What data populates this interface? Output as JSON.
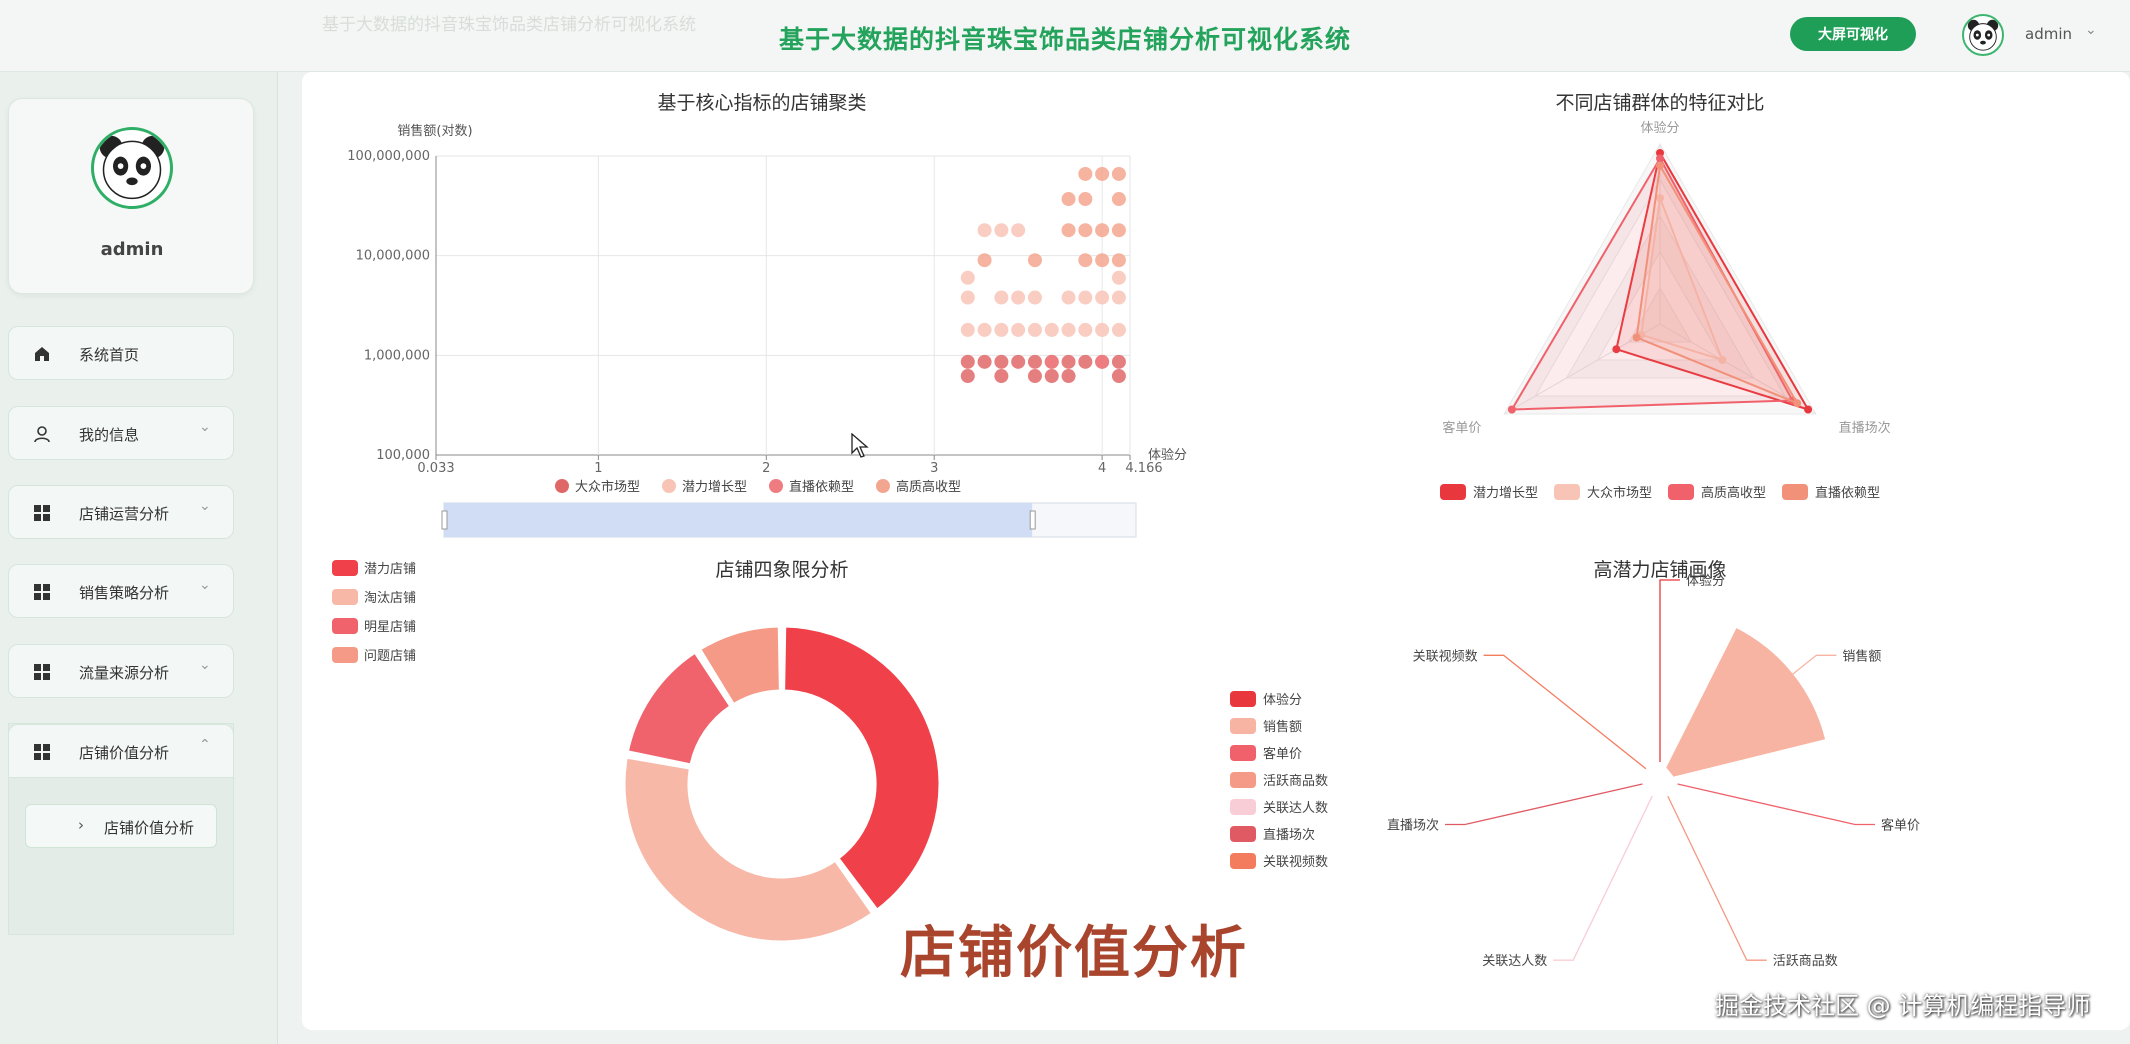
{
  "header": {
    "faint_title": "基于大数据的抖音珠宝饰品类店铺分析可视化系统",
    "title": "基于大数据的抖音珠宝饰品类店铺分析可视化系统",
    "screen_button": "大屏可视化",
    "username": "admin",
    "caret": "⌄"
  },
  "sidebar": {
    "profile_name": "admin",
    "items": [
      {
        "label": "系统首页",
        "icon": "home-icon",
        "caret": ""
      },
      {
        "label": "我的信息",
        "icon": "user-icon",
        "caret": "⌄"
      },
      {
        "label": "店铺运营分析",
        "icon": "grid-icon",
        "caret": "⌄"
      },
      {
        "label": "销售策略分析",
        "icon": "grid-icon",
        "caret": "⌄"
      },
      {
        "label": "流量来源分析",
        "icon": "grid-icon",
        "caret": "⌄"
      },
      {
        "label": "店铺价值分析",
        "icon": "grid-icon",
        "caret": "⌃"
      }
    ],
    "sub_item": {
      "label": "店铺价值分析",
      "arrow": "›"
    }
  },
  "overlay_text": "店铺价值分析",
  "watermark": "掘金技术社区 @ 计算机编程指导师",
  "colors": {
    "accent": "#23a35b",
    "red": "#e8383d",
    "salmon": "#f7b4a3",
    "pink": "#f0616b",
    "peach": "#f2917a"
  },
  "chart_data": [
    {
      "type": "scatter",
      "title": "基于核心指标的店铺聚类",
      "ylabel": "销售额(对数)",
      "xlabel": "体验分",
      "y_scale": "log",
      "ylim": [
        100000,
        100000000
      ],
      "y_ticks": [
        "100,000",
        "1,000,000",
        "10,000,000",
        "100,000,000"
      ],
      "xlim": [
        0.033,
        4.166
      ],
      "x_ticks": [
        "0.033",
        "1",
        "2",
        "3",
        "4",
        "4.166"
      ],
      "legend": [
        "大众市场型",
        "潜力增长型",
        "直播依赖型",
        "高质高收型"
      ],
      "legend_colors": [
        "#e06767",
        "#f8c4b6",
        "#ef7c80",
        "#f3a68f"
      ],
      "datazoom_range": [
        0,
        0.85
      ],
      "series": [
        {
          "name": "高质高收型",
          "x": [
            3.9,
            4.0,
            4.1,
            3.8,
            3.9,
            4.1,
            3.8,
            3.9,
            4.0,
            4.1,
            3.3,
            3.6,
            3.9,
            4.0,
            4.1
          ],
          "y": [
            66000000,
            66000000,
            66000000,
            37000000,
            37000000,
            37000000,
            18000000,
            18000000,
            18000000,
            18000000,
            9000000,
            9000000,
            9000000,
            9000000,
            9000000
          ]
        },
        {
          "name": "潜力增长型",
          "x": [
            3.3,
            3.4,
            3.5,
            3.2,
            3.2,
            3.4,
            3.5,
            3.6,
            3.8,
            3.9,
            4.0,
            4.1,
            4.1,
            3.2,
            3.3,
            3.4,
            3.5,
            3.6,
            3.7,
            3.8,
            3.9,
            4.0,
            4.1
          ],
          "y": [
            18000000,
            18000000,
            18000000,
            6000000,
            3800000,
            3800000,
            3800000,
            3800000,
            3800000,
            3800000,
            3800000,
            3800000,
            6000000,
            1800000,
            1800000,
            1800000,
            1800000,
            1800000,
            1800000,
            1800000,
            1800000,
            1800000,
            1800000
          ]
        },
        {
          "name": "大众市场型",
          "x": [
            3.2,
            3.3,
            3.4,
            3.5,
            3.6,
            3.7,
            3.8,
            3.9,
            4.0,
            4.1,
            3.2,
            3.4,
            3.6,
            3.7,
            3.8,
            4.1
          ],
          "y": [
            860000,
            860000,
            860000,
            860000,
            860000,
            860000,
            860000,
            860000,
            860000,
            860000,
            620000,
            620000,
            620000,
            620000,
            620000,
            620000
          ]
        },
        {
          "name": "直播依赖型",
          "x": [
            3.7,
            4.0
          ],
          "y": [
            860000,
            860000
          ]
        }
      ]
    },
    {
      "type": "radar",
      "title": "不同店铺群体的特征对比",
      "indicators": [
        "体验分",
        "直播场次",
        "客单价"
      ],
      "legend": [
        "潜力增长型",
        "大众市场型",
        "高质高收型",
        "直播依赖型"
      ],
      "legend_colors": [
        "#e8383d",
        "#f8c4b6",
        "#f0616b",
        "#f2917a"
      ],
      "series": [
        {
          "name": "潜力增长型",
          "values": [
            0.95,
            0.95,
            0.28
          ]
        },
        {
          "name": "大众市场型",
          "values": [
            0.7,
            0.4,
            0.12
          ]
        },
        {
          "name": "高质高收型",
          "values": [
            0.92,
            0.85,
            0.95
          ]
        },
        {
          "name": "直播依赖型",
          "values": [
            0.88,
            0.88,
            0.15
          ]
        }
      ]
    },
    {
      "type": "pie",
      "title": "店铺四象限分析",
      "legend": [
        "潜力店铺",
        "淘汰店铺",
        "明星店铺",
        "问题店铺"
      ],
      "colors": [
        "#f0414a",
        "#f8b8a8",
        "#f0626c",
        "#f59a86"
      ],
      "values": [
        40,
        38,
        13,
        9
      ]
    },
    {
      "type": "pie",
      "title": "高潜力店铺画像",
      "rose": true,
      "legend": [
        "体验分",
        "销售额",
        "客单价",
        "活跃商品数",
        "关联达人数",
        "直播场次",
        "关联视频数"
      ],
      "legend_colors": [
        "#e8383d",
        "#f8b4a2",
        "#f0616b",
        "#f59a86",
        "#f9cdd6",
        "#e05a64",
        "#f47c5e"
      ],
      "values": [
        0.05,
        1.0,
        0.05,
        0.05,
        0.05,
        0.05,
        0.05
      ]
    }
  ]
}
